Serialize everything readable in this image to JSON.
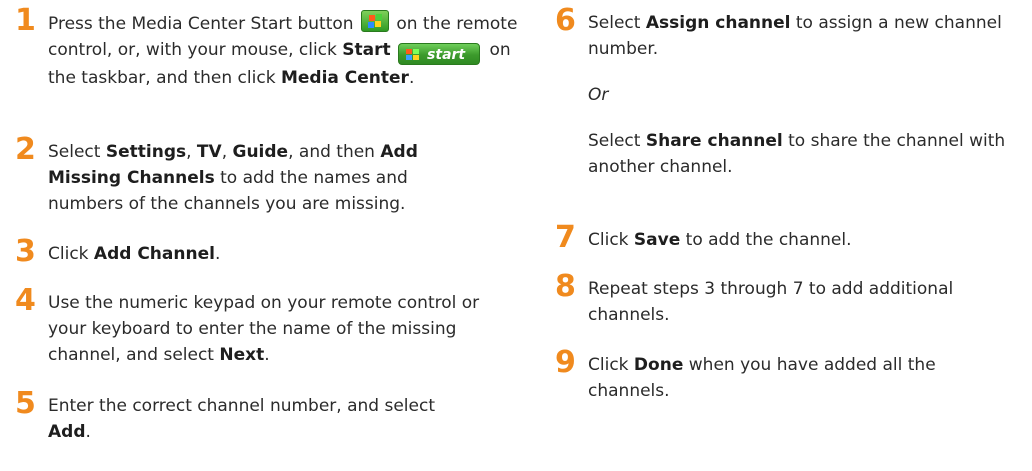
{
  "left_steps": [
    {
      "num": "1",
      "t1": "Press the Media Center Start button ",
      "t2": " on the remote control, or, with your mouse, click ",
      "b1": "Start",
      "start_label": "start",
      "t3": " on the taskbar, and then click ",
      "b2": "Media Center",
      "t4": "."
    },
    {
      "num": "2",
      "t1": "Select ",
      "b1": "Settings",
      "t2": ", ",
      "b2": "TV",
      "t3": ", ",
      "b3": "Guide",
      "t4": ", and then ",
      "b4": "Add Missing Channels",
      "t5": " to add the names and numbers of the channels you are missing."
    },
    {
      "num": "3",
      "t1": "Click ",
      "b1": "Add Channel",
      "t2": "."
    },
    {
      "num": "4",
      "t1": "Use the numeric keypad on your remote control or your keyboard to enter the name of the missing channel, and select ",
      "b1": "Next",
      "t2": "."
    },
    {
      "num": "5",
      "t1": "Enter the correct channel number, and select ",
      "b1": "Add",
      "t2": "."
    }
  ],
  "right_steps": [
    {
      "num": "6",
      "t1": "Select ",
      "b1": "Assign channel",
      "t2": " to assign a new channel number.",
      "or": "Or",
      "t3": "Select ",
      "b2": "Share channel",
      "t4": " to share the channel with another channel."
    },
    {
      "num": "7",
      "t1": "Click ",
      "b1": "Save",
      "t2": " to add the channel."
    },
    {
      "num": "8",
      "t1": "Repeat steps 3 through 7 to add additional channels."
    },
    {
      "num": "9",
      "t1": "Click ",
      "b1": "Done",
      "t2": " when you have added all the channels."
    }
  ],
  "colors": {
    "step_number": "#f08a1e",
    "text": "#2b2b2b",
    "start_button": "#3c9a2c"
  },
  "icons": {
    "media_center_button": "media-center-start-icon",
    "start_button": "windows-start-button"
  }
}
